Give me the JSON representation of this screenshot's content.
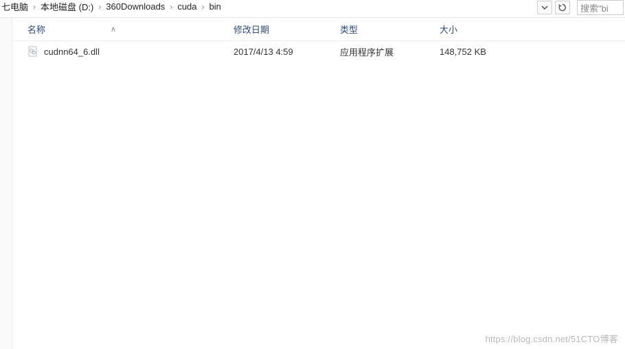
{
  "breadcrumb": {
    "items": [
      "七电脑",
      "本地磁盘 (D:)",
      "360Downloads",
      "cuda",
      "bin"
    ]
  },
  "search": {
    "placeholder": "搜索\"bi"
  },
  "columns": {
    "name": "名称",
    "date": "修改日期",
    "type": "类型",
    "size": "大小",
    "sort_indicator": "∧"
  },
  "files": [
    {
      "name": "cudnn64_6.dll",
      "date": "2017/4/13 4:59",
      "type": "应用程序扩展",
      "size": "148,752 KB",
      "icon": "dll-file-icon"
    }
  ],
  "watermark": {
    "line1": "https://blog.csdn.net/51CTO博客"
  }
}
